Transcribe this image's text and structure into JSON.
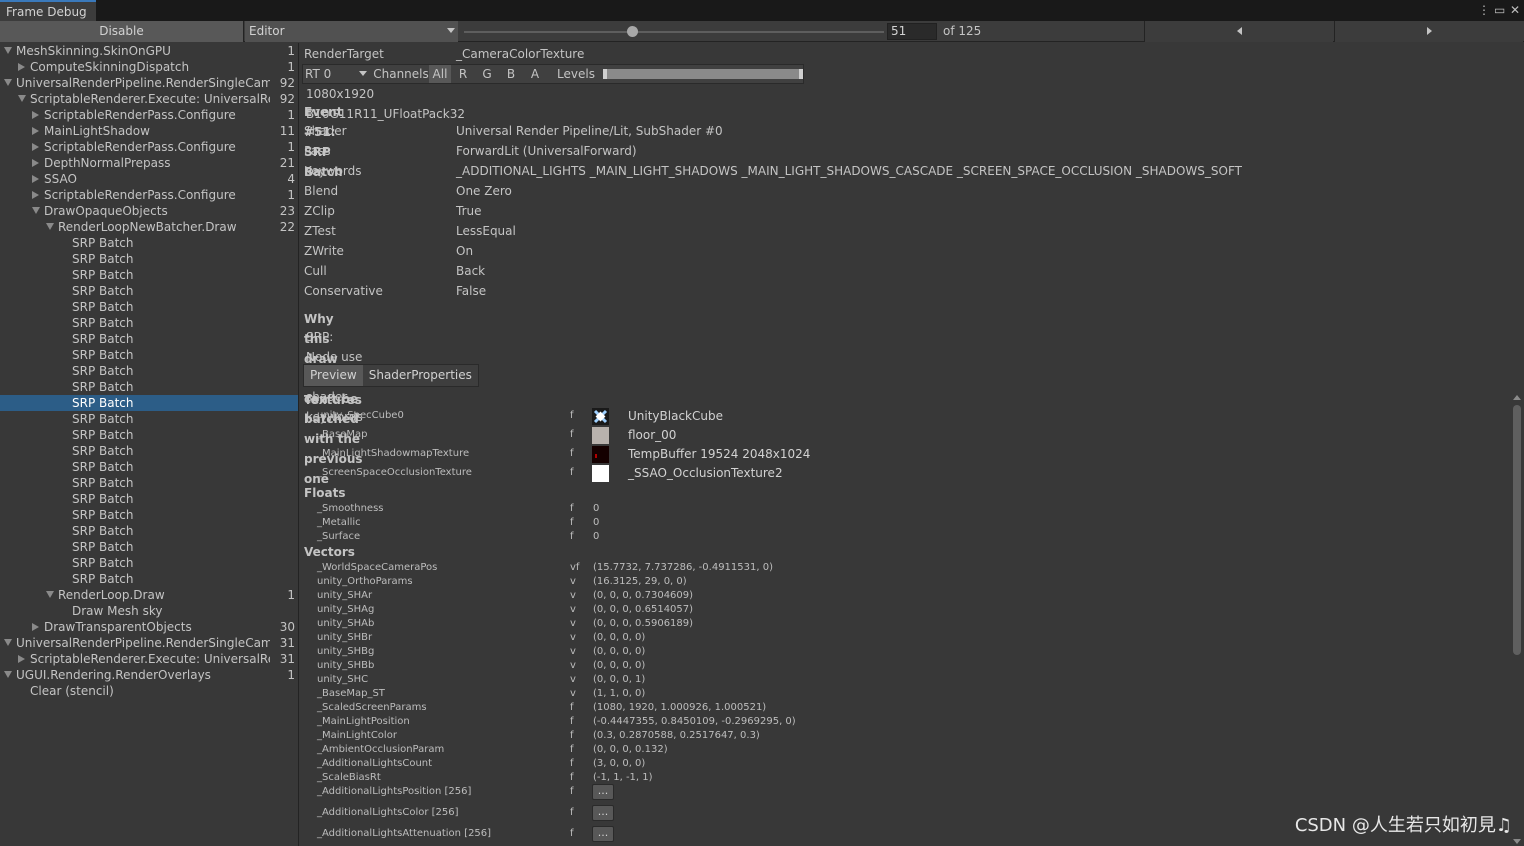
{
  "window": {
    "tab_title": "Frame Debug",
    "menu_icon": "kebab-menu-icon",
    "maximize_icon": "maximize-icon",
    "close_icon": "close-icon"
  },
  "toolbar": {
    "disable_label": "Disable",
    "target_dropdown": "Editor",
    "frame_value": "51",
    "frame_total_label": "of 125",
    "slider_fraction": 0.4,
    "prev_icon": "triangle-left-icon",
    "next_icon": "triangle-right-icon"
  },
  "tree": [
    {
      "label": "MeshSkinning.SkinOnGPU",
      "count": "1",
      "depth": 0,
      "arrow": "down"
    },
    {
      "label": "ComputeSkinningDispatch",
      "count": "1",
      "depth": 1,
      "arrow": "right"
    },
    {
      "label": "UniversalRenderPipeline.RenderSingleCamera: Main Camera",
      "count": "92",
      "depth": 0,
      "arrow": "down"
    },
    {
      "label": "ScriptableRenderer.Execute: UniversalRenderer",
      "count": "92",
      "depth": 1,
      "arrow": "down"
    },
    {
      "label": "ScriptableRenderPass.Configure",
      "count": "1",
      "depth": 2,
      "arrow": "right"
    },
    {
      "label": "MainLightShadow",
      "count": "11",
      "depth": 2,
      "arrow": "right"
    },
    {
      "label": "ScriptableRenderPass.Configure",
      "count": "1",
      "depth": 2,
      "arrow": "right"
    },
    {
      "label": "DepthNormalPrepass",
      "count": "21",
      "depth": 2,
      "arrow": "right"
    },
    {
      "label": "SSAO",
      "count": "4",
      "depth": 2,
      "arrow": "right"
    },
    {
      "label": "ScriptableRenderPass.Configure",
      "count": "1",
      "depth": 2,
      "arrow": "right"
    },
    {
      "label": "DrawOpaqueObjects",
      "count": "23",
      "depth": 2,
      "arrow": "down"
    },
    {
      "label": "RenderLoopNewBatcher.Draw",
      "count": "22",
      "depth": 3,
      "arrow": "down"
    },
    {
      "label": "SRP Batch",
      "count": "",
      "depth": 4,
      "arrow": ""
    },
    {
      "label": "SRP Batch",
      "count": "",
      "depth": 4,
      "arrow": ""
    },
    {
      "label": "SRP Batch",
      "count": "",
      "depth": 4,
      "arrow": ""
    },
    {
      "label": "SRP Batch",
      "count": "",
      "depth": 4,
      "arrow": ""
    },
    {
      "label": "SRP Batch",
      "count": "",
      "depth": 4,
      "arrow": ""
    },
    {
      "label": "SRP Batch",
      "count": "",
      "depth": 4,
      "arrow": ""
    },
    {
      "label": "SRP Batch",
      "count": "",
      "depth": 4,
      "arrow": ""
    },
    {
      "label": "SRP Batch",
      "count": "",
      "depth": 4,
      "arrow": ""
    },
    {
      "label": "SRP Batch",
      "count": "",
      "depth": 4,
      "arrow": ""
    },
    {
      "label": "SRP Batch",
      "count": "",
      "depth": 4,
      "arrow": ""
    },
    {
      "label": "SRP Batch",
      "count": "",
      "depth": 4,
      "arrow": "",
      "selected": true
    },
    {
      "label": "SRP Batch",
      "count": "",
      "depth": 4,
      "arrow": ""
    },
    {
      "label": "SRP Batch",
      "count": "",
      "depth": 4,
      "arrow": ""
    },
    {
      "label": "SRP Batch",
      "count": "",
      "depth": 4,
      "arrow": ""
    },
    {
      "label": "SRP Batch",
      "count": "",
      "depth": 4,
      "arrow": ""
    },
    {
      "label": "SRP Batch",
      "count": "",
      "depth": 4,
      "arrow": ""
    },
    {
      "label": "SRP Batch",
      "count": "",
      "depth": 4,
      "arrow": ""
    },
    {
      "label": "SRP Batch",
      "count": "",
      "depth": 4,
      "arrow": ""
    },
    {
      "label": "SRP Batch",
      "count": "",
      "depth": 4,
      "arrow": ""
    },
    {
      "label": "SRP Batch",
      "count": "",
      "depth": 4,
      "arrow": ""
    },
    {
      "label": "SRP Batch",
      "count": "",
      "depth": 4,
      "arrow": ""
    },
    {
      "label": "SRP Batch",
      "count": "",
      "depth": 4,
      "arrow": ""
    },
    {
      "label": "RenderLoop.Draw",
      "count": "1",
      "depth": 3,
      "arrow": "down"
    },
    {
      "label": "Draw Mesh sky",
      "count": "",
      "depth": 4,
      "arrow": ""
    },
    {
      "label": "DrawTransparentObjects",
      "count": "30",
      "depth": 2,
      "arrow": "right"
    },
    {
      "label": "UniversalRenderPipeline.RenderSingleCamera: UI Camera",
      "count": "31",
      "depth": 0,
      "arrow": "down"
    },
    {
      "label": "ScriptableRenderer.Execute: UniversalRenderer",
      "count": "31",
      "depth": 1,
      "arrow": "right"
    },
    {
      "label": "UGUI.Rendering.RenderOverlays",
      "count": "1",
      "depth": 0,
      "arrow": "down"
    },
    {
      "label": "Clear (stencil)",
      "count": "",
      "depth": 1,
      "arrow": ""
    }
  ],
  "details": {
    "render_target_label": "RenderTarget",
    "render_target_value": "_CameraColorTexture",
    "rt_dropdown": "RT 0",
    "channels_label": "Channels",
    "channels": [
      "All",
      "R",
      "G",
      "B",
      "A"
    ],
    "levels_label": "Levels",
    "resolution": "1080x1920 B10G11R11_UFloatPack32",
    "event_title": "Event #51: SRP Batch",
    "fields": [
      {
        "key": "Shader",
        "value": "Universal Render Pipeline/Lit, SubShader #0"
      },
      {
        "key": "Pass",
        "value": "ForwardLit (UniversalForward)"
      },
      {
        "key": "Keywords",
        "value": "_ADDITIONAL_LIGHTS _MAIN_LIGHT_SHADOWS _MAIN_LIGHT_SHADOWS_CASCADE _SCREEN_SPACE_OCCLUSION _SHADOWS_SOFT"
      },
      {
        "key": "Blend",
        "value": "One Zero"
      },
      {
        "key": "ZClip",
        "value": "True"
      },
      {
        "key": "ZTest",
        "value": "LessEqual"
      },
      {
        "key": "ZWrite",
        "value": "On"
      },
      {
        "key": "Cull",
        "value": "Back"
      },
      {
        "key": "Conservative",
        "value": "False"
      }
    ],
    "batch_reason_title": "Why this draw call can't be batched with the previous one",
    "batch_reason": "SRP: Node use different shader keywords",
    "tabs": [
      "Preview",
      "ShaderProperties"
    ],
    "textures_title": "Textures",
    "textures": [
      {
        "name": "unity_SpecCube0",
        "type": "f",
        "value": "UnityBlackCube",
        "thumb": "cube-texture-icon"
      },
      {
        "name": "_BaseMap",
        "type": "f",
        "value": "floor_00",
        "thumb": "texture-thumbnail"
      },
      {
        "name": "_MainLightShadowmapTexture",
        "type": "f",
        "value": "TempBuffer 19524 2048x1024",
        "thumb": "texture-thumbnail"
      },
      {
        "name": "_ScreenSpaceOcclusionTexture",
        "type": "f",
        "value": "_SSAO_OcclusionTexture2",
        "thumb": "texture-thumbnail"
      }
    ],
    "floats_title": "Floats",
    "floats": [
      {
        "name": "_Smoothness",
        "type": "f",
        "value": "0"
      },
      {
        "name": "_Metallic",
        "type": "f",
        "value": "0"
      },
      {
        "name": "_Surface",
        "type": "f",
        "value": "0"
      }
    ],
    "vectors_title": "Vectors",
    "vectors": [
      {
        "name": "_WorldSpaceCameraPos",
        "type": "vf",
        "value": "(15.7732, 7.737286, -0.4911531, 0)"
      },
      {
        "name": "unity_OrthoParams",
        "type": "v",
        "value": "(16.3125, 29, 0, 0)"
      },
      {
        "name": "unity_SHAr",
        "type": "v",
        "value": "(0, 0, 0, 0.7304609)"
      },
      {
        "name": "unity_SHAg",
        "type": "v",
        "value": "(0, 0, 0, 0.6514057)"
      },
      {
        "name": "unity_SHAb",
        "type": "v",
        "value": "(0, 0, 0, 0.5906189)"
      },
      {
        "name": "unity_SHBr",
        "type": "v",
        "value": "(0, 0, 0, 0)"
      },
      {
        "name": "unity_SHBg",
        "type": "v",
        "value": "(0, 0, 0, 0)"
      },
      {
        "name": "unity_SHBb",
        "type": "v",
        "value": "(0, 0, 0, 0)"
      },
      {
        "name": "unity_SHC",
        "type": "v",
        "value": "(0, 0, 0, 1)"
      },
      {
        "name": "_BaseMap_ST",
        "type": "v",
        "value": "(1, 1, 0, 0)"
      },
      {
        "name": "_ScaledScreenParams",
        "type": "f",
        "value": "(1080, 1920, 1.000926, 1.000521)"
      },
      {
        "name": "_MainLightPosition",
        "type": "f",
        "value": "(-0.4447355, 0.8450109, -0.2969295, 0)"
      },
      {
        "name": "_MainLightColor",
        "type": "f",
        "value": "(0.3, 0.2870588, 0.2517647, 0.3)"
      },
      {
        "name": "_AmbientOcclusionParam",
        "type": "f",
        "value": "(0, 0, 0, 0.132)"
      },
      {
        "name": "_AdditionalLightsCount",
        "type": "f",
        "value": "(3, 0, 0, 0)"
      },
      {
        "name": "_ScaleBiasRt",
        "type": "f",
        "value": "(-1, 1, -1, 1)"
      }
    ],
    "arrays": [
      {
        "name": "_AdditionalLightsPosition [256]",
        "type": "f",
        "button": "..."
      },
      {
        "name": "_AdditionalLightsColor [256]",
        "type": "f",
        "button": "..."
      },
      {
        "name": "_AdditionalLightsAttenuation [256]",
        "type": "f",
        "button": "..."
      }
    ]
  },
  "watermark": "CSDN @人生若只如初見♫",
  "colors": {
    "background": "#383838",
    "selection": "#2c5d87",
    "tab_accent": "#3a79bb"
  }
}
